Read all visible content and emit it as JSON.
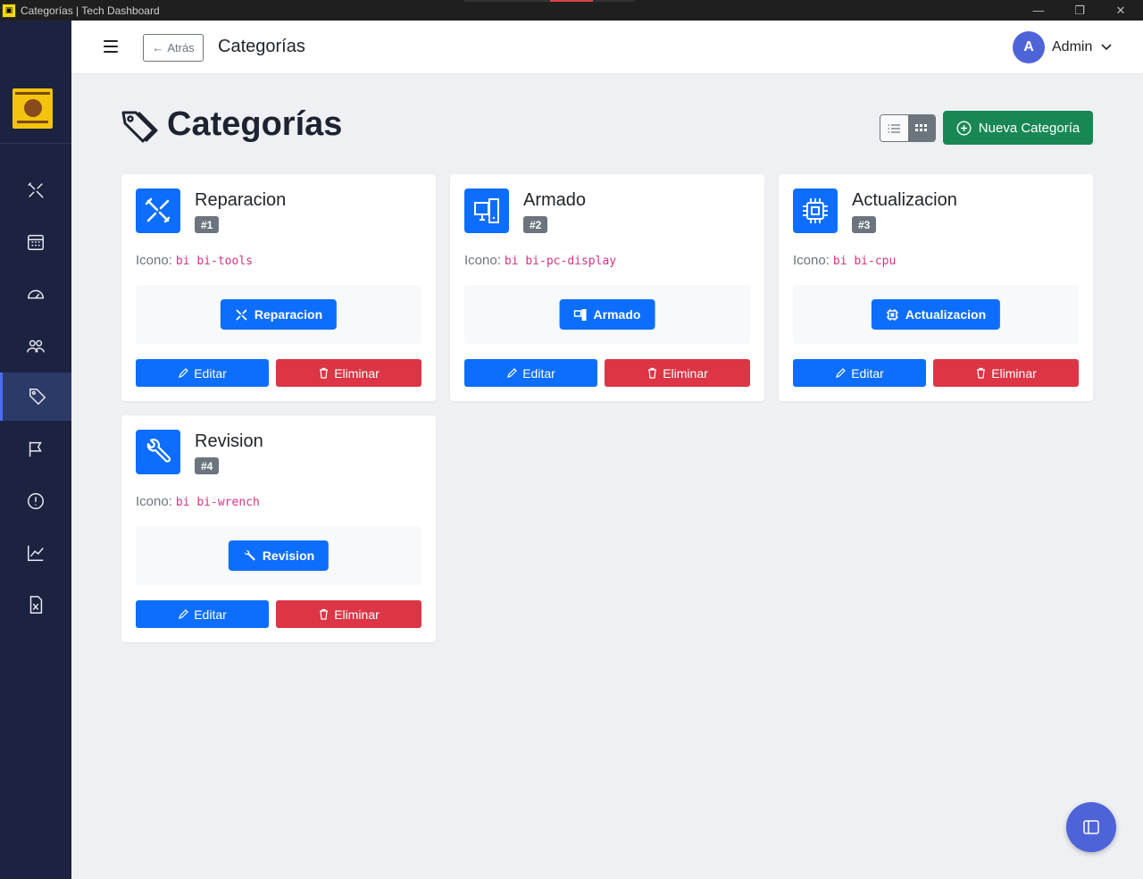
{
  "window": {
    "title": "Categorías | Tech Dashboard",
    "minimize": "—",
    "maximize": "❐",
    "close": "✕"
  },
  "sidebar": {
    "logo_alt": "SERVICIO TÉCNICO EN COMPUTACIÓN",
    "items": [
      {
        "icon": "tools-icon",
        "active": false
      },
      {
        "icon": "calendar-icon",
        "active": false
      },
      {
        "icon": "speedometer-icon",
        "active": false
      },
      {
        "icon": "people-icon",
        "active": false
      },
      {
        "icon": "tags-icon",
        "active": true
      },
      {
        "icon": "flag-icon",
        "active": false
      },
      {
        "icon": "exclamation-circle-icon",
        "active": false
      },
      {
        "icon": "graph-up-icon",
        "active": false
      },
      {
        "icon": "file-excel-icon",
        "active": false
      }
    ]
  },
  "header": {
    "back_label": "Atrás",
    "title": "Categorías",
    "user_initial": "A",
    "user_name": "Admin"
  },
  "page": {
    "title": "Categorías",
    "new_button": "Nueva Categoría",
    "view_modes": [
      "list",
      "grid"
    ],
    "active_view": "grid"
  },
  "labels": {
    "icon_prefix": "Icono:",
    "edit": "Editar",
    "delete": "Eliminar"
  },
  "categories": [
    {
      "name": "Reparacion",
      "badge": "#1",
      "icon_class": "bi bi-tools",
      "icon": "tools-icon"
    },
    {
      "name": "Armado",
      "badge": "#2",
      "icon_class": "bi bi-pc-display",
      "icon": "pc-display-icon"
    },
    {
      "name": "Actualizacion",
      "badge": "#3",
      "icon_class": "bi bi-cpu",
      "icon": "cpu-icon"
    },
    {
      "name": "Revision",
      "badge": "#4",
      "icon_class": "bi bi-wrench",
      "icon": "wrench-icon"
    }
  ],
  "colors": {
    "primary": "#0d6efd",
    "danger": "#dc3545",
    "success": "#198754",
    "sidebar": "#1c2340",
    "accent": "#4f63d9"
  }
}
